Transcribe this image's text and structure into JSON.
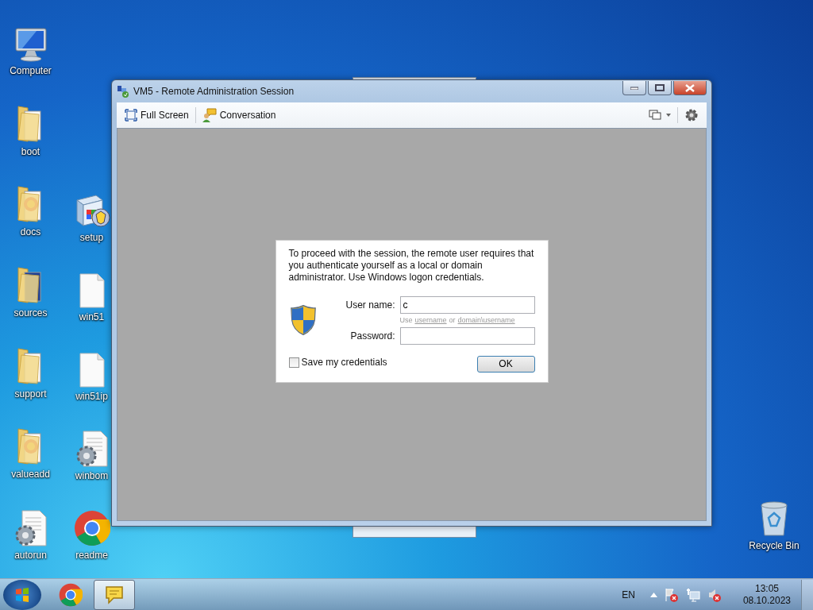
{
  "desktop": {
    "columns": [
      [
        {
          "label": "Computer",
          "kind": "computer"
        },
        {
          "label": "boot",
          "kind": "folder"
        },
        {
          "label": "docs",
          "kind": "folder-color"
        },
        {
          "label": "sources",
          "kind": "folder-blue"
        },
        {
          "label": "support",
          "kind": "folder"
        },
        {
          "label": "valueadd",
          "kind": "folder-color"
        },
        {
          "label": "autorun",
          "kind": "gear-doc"
        }
      ],
      [
        {
          "label": "setup",
          "kind": "installer"
        },
        {
          "label": "win51",
          "kind": "doc"
        },
        {
          "label": "win51ip",
          "kind": "doc"
        },
        {
          "label": "winbom",
          "kind": "gear-doc"
        },
        {
          "label": "readme",
          "kind": "chrome"
        }
      ]
    ],
    "recycle_bin": {
      "label": "Recycle Bin"
    }
  },
  "window": {
    "title": "VM5 - Remote Administration Session",
    "toolbar": [
      {
        "label": "Full Screen",
        "kind": "fullscreen"
      },
      {
        "label": "Conversation",
        "kind": "chat"
      }
    ],
    "dialog": {
      "message": "To proceed with the session, the remote user requires that you authenticate yourself as a local or domain administrator. Use Windows logon credentials.",
      "username_label": "User name:",
      "username_value": "c",
      "hint_prefix": "Use",
      "hint_link_1": "username",
      "hint_middle": "or",
      "hint_link_2": "domain\\username",
      "password_label": "Password:",
      "save_credentials": {
        "label": "Save my credentials",
        "checked": false
      },
      "ok_button": "OK"
    }
  },
  "taskbar": {
    "apps": [
      {
        "kind": "chrome",
        "selected": false
      },
      {
        "kind": "notes",
        "selected": true
      }
    ],
    "language": "EN",
    "time": "13:05",
    "date": "08.10.2023"
  }
}
